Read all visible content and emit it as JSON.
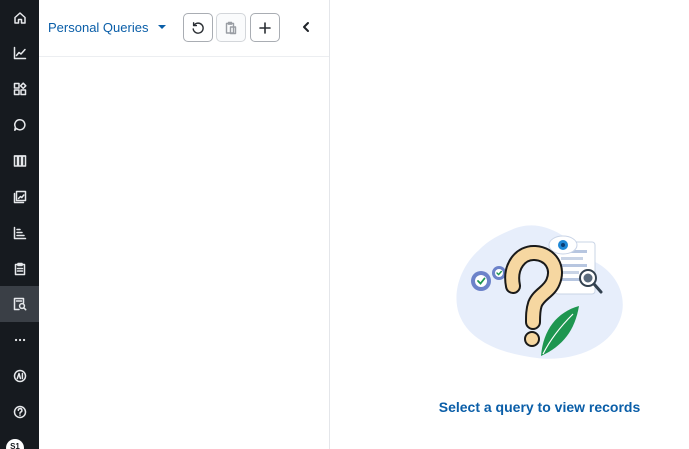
{
  "rail": {
    "items": [
      {
        "icon": "home-icon"
      },
      {
        "icon": "line-chart-icon"
      },
      {
        "icon": "widgets-icon"
      },
      {
        "icon": "chat-icon"
      },
      {
        "icon": "board-columns-icon"
      },
      {
        "icon": "report-icon"
      },
      {
        "icon": "bar-chart-icon"
      },
      {
        "icon": "clipboard-icon"
      },
      {
        "icon": "query-search-icon",
        "active": true
      },
      {
        "icon": "more-icon"
      },
      {
        "icon": "ai-icon"
      },
      {
        "icon": "help-icon"
      }
    ],
    "avatar_initials": "S1"
  },
  "panel": {
    "query_select_label": "Personal Queries",
    "buttons": [
      "refresh-icon",
      "copy-icon",
      "plus-icon"
    ],
    "collapse_icon": "chevron-left-icon"
  },
  "main": {
    "empty_message": "Select a query to view records"
  },
  "colors": {
    "rail_bg": "#161a1f",
    "accent": "#0a5ea8",
    "illustration_blob": "#e7eefb",
    "question_mark": "#f6d7a1",
    "leaf": "#1e9650"
  }
}
